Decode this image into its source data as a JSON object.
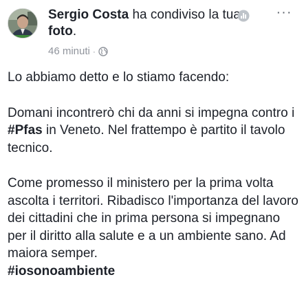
{
  "header": {
    "author": "Sergio Costa",
    "action": " ha condiviso la tua ",
    "object": "foto",
    "period": ".",
    "time": "46 minuti",
    "separator": "·",
    "more_label": "···",
    "avatar_icon": "profile-photo",
    "globe_icon": "globe-icon",
    "stats_icon": "bar-chart-icon"
  },
  "post": {
    "p1": "Lo abbiamo detto e lo stiamo facendo:",
    "p2a": "Domani incontrerò chi da anni si impegna contro i ",
    "p2_tag": "#Pfas",
    "p2b": " in Veneto. Nel frattempo è partito il tavolo tecnico.",
    "p3": "Come promesso il ministero per la prima volta ascolta i territori. Ribadisco l'importanza del lavoro dei cittadini che in prima persona si impegnano per il diritto alla salute e a un ambiente sano. Ad maiora semper.",
    "p3_tag": "#iosonoambiente"
  },
  "colors": {
    "text": "#1d2129",
    "meta": "#90949c",
    "icon": "#606770"
  }
}
